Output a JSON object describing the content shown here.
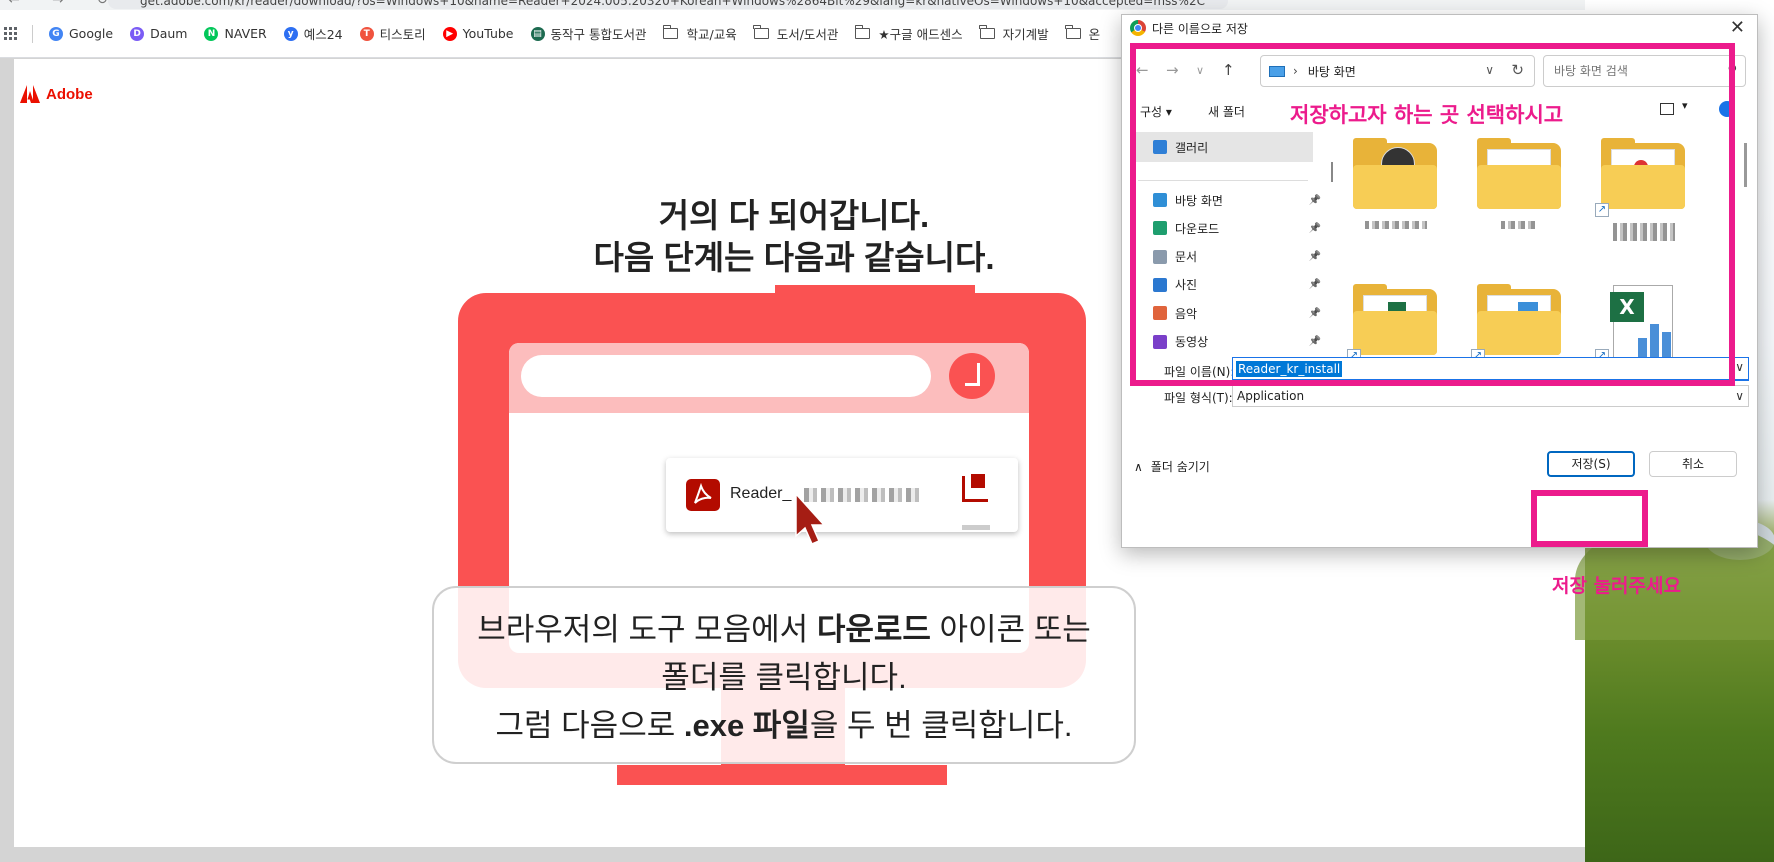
{
  "browser": {
    "url": "get.adobe.com/kr/reader/download/?os=Windows+10&name=Reader+2024.005.20320+Korean+Windows%2864Bit%29&lang=kr&nativeOs=Windows+10&accepted=mss%2C",
    "bookmarks": [
      {
        "label": "Google",
        "type": "site",
        "color": "#4285f4",
        "glyph": "G"
      },
      {
        "label": "Daum",
        "type": "site",
        "color": "#7b5cf5",
        "glyph": "D"
      },
      {
        "label": "NAVER",
        "type": "site",
        "color": "#03c75a",
        "glyph": "N"
      },
      {
        "label": "예스24",
        "type": "site",
        "color": "#2d6ff2",
        "glyph": "y"
      },
      {
        "label": "티스토리",
        "type": "site",
        "color": "#f0533e",
        "glyph": "T"
      },
      {
        "label": "YouTube",
        "type": "site",
        "color": "#ff0000",
        "glyph": "▶"
      },
      {
        "label": "동작구 통합도서관",
        "type": "site",
        "color": "#1d6b50",
        "glyph": "▤"
      },
      {
        "label": "학교/교육",
        "type": "folder"
      },
      {
        "label": "도서/도서관",
        "type": "folder"
      },
      {
        "label": "★구글 애드센스",
        "type": "folder"
      },
      {
        "label": "자기계발",
        "type": "folder"
      },
      {
        "label": "온",
        "type": "folder"
      }
    ]
  },
  "page": {
    "logo_text": "Adobe",
    "headline_line1": "거의 다 되어갑니다.",
    "headline_line2": "다음 단계는 다음과 같습니다.",
    "download_chip_name": "Reader_",
    "instruction": {
      "p1_pre": "브라우저의 도구 모음에서 ",
      "p1_bold": "다운로드",
      "p1_post": " 아이콘 또는 폴더를 클릭합니다.",
      "p2_pre": "그럼 다음으로 ",
      "p2_bold": ".exe 파일",
      "p2_post": "을 두 번 클릭합니다."
    }
  },
  "dialog": {
    "title": "다른 이름으로 저장",
    "close_glyph": "✕",
    "address_location": "바탕 화면",
    "search_placeholder": "바탕 화면 검색",
    "toolbar_organize": "구성 ▾",
    "toolbar_new_folder": "새 폴더",
    "nav_items": [
      {
        "label": "갤러리",
        "icon": "gallery-icon",
        "color": "#2f7fd6"
      },
      {
        "label": "바탕 화면",
        "icon": "desktop-icon",
        "color": "#2f8fd6"
      },
      {
        "label": "다운로드",
        "icon": "download-icon",
        "color": "#1e9e6e"
      },
      {
        "label": "문서",
        "icon": "document-icon",
        "color": "#8a9aac"
      },
      {
        "label": "사진",
        "icon": "picture-icon",
        "color": "#2b78d0"
      },
      {
        "label": "음악",
        "icon": "music-icon",
        "color": "#e0643c"
      },
      {
        "label": "동영상",
        "icon": "video-icon",
        "color": "#7a3fc9"
      }
    ],
    "file_name_label": "파일 이름(N):",
    "file_name_value": "Reader_kr_install",
    "file_type_label": "파일 형식(T):",
    "file_type_value": "Application",
    "hide_folders_label": "폴더 숨기기",
    "save_label": "저장(S)",
    "cancel_label": "취소"
  },
  "annotations": {
    "select_location": "저장하고자 하는 곳 선택하시고",
    "press_save": "저장 눌러주세요",
    "color": "#ec1b8c"
  }
}
